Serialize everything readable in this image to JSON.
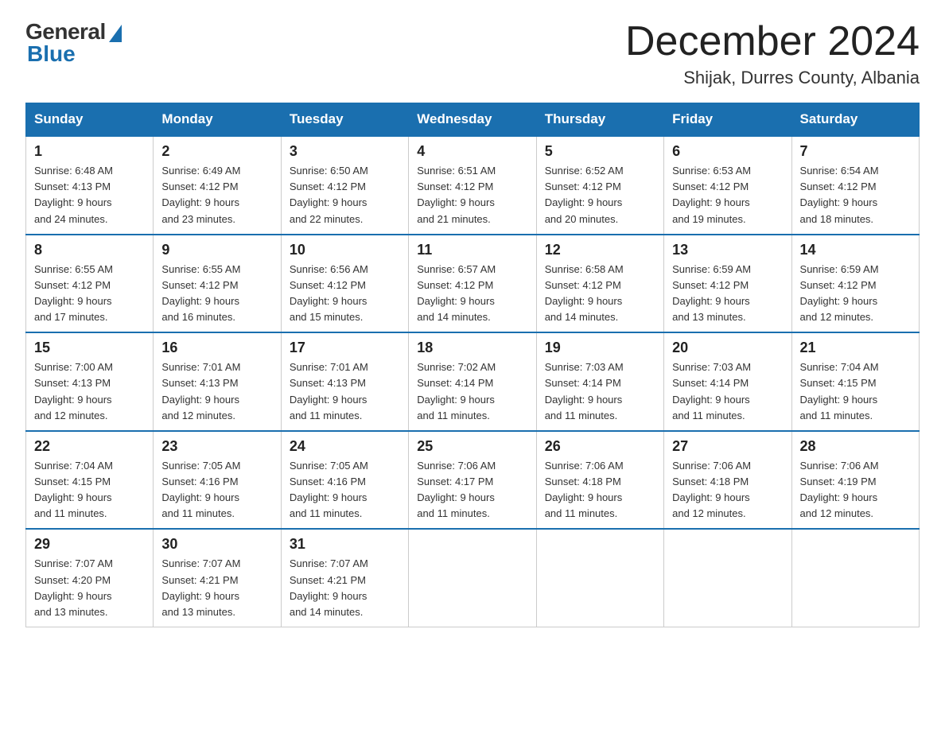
{
  "header": {
    "logo_general": "General",
    "logo_blue": "Blue",
    "month_title": "December 2024",
    "location": "Shijak, Durres County, Albania"
  },
  "days_of_week": [
    "Sunday",
    "Monday",
    "Tuesday",
    "Wednesday",
    "Thursday",
    "Friday",
    "Saturday"
  ],
  "weeks": [
    [
      {
        "day": "1",
        "sunrise": "6:48 AM",
        "sunset": "4:13 PM",
        "daylight": "9 hours and 24 minutes."
      },
      {
        "day": "2",
        "sunrise": "6:49 AM",
        "sunset": "4:12 PM",
        "daylight": "9 hours and 23 minutes."
      },
      {
        "day": "3",
        "sunrise": "6:50 AM",
        "sunset": "4:12 PM",
        "daylight": "9 hours and 22 minutes."
      },
      {
        "day": "4",
        "sunrise": "6:51 AM",
        "sunset": "4:12 PM",
        "daylight": "9 hours and 21 minutes."
      },
      {
        "day": "5",
        "sunrise": "6:52 AM",
        "sunset": "4:12 PM",
        "daylight": "9 hours and 20 minutes."
      },
      {
        "day": "6",
        "sunrise": "6:53 AM",
        "sunset": "4:12 PM",
        "daylight": "9 hours and 19 minutes."
      },
      {
        "day": "7",
        "sunrise": "6:54 AM",
        "sunset": "4:12 PM",
        "daylight": "9 hours and 18 minutes."
      }
    ],
    [
      {
        "day": "8",
        "sunrise": "6:55 AM",
        "sunset": "4:12 PM",
        "daylight": "9 hours and 17 minutes."
      },
      {
        "day": "9",
        "sunrise": "6:55 AM",
        "sunset": "4:12 PM",
        "daylight": "9 hours and 16 minutes."
      },
      {
        "day": "10",
        "sunrise": "6:56 AM",
        "sunset": "4:12 PM",
        "daylight": "9 hours and 15 minutes."
      },
      {
        "day": "11",
        "sunrise": "6:57 AM",
        "sunset": "4:12 PM",
        "daylight": "9 hours and 14 minutes."
      },
      {
        "day": "12",
        "sunrise": "6:58 AM",
        "sunset": "4:12 PM",
        "daylight": "9 hours and 14 minutes."
      },
      {
        "day": "13",
        "sunrise": "6:59 AM",
        "sunset": "4:12 PM",
        "daylight": "9 hours and 13 minutes."
      },
      {
        "day": "14",
        "sunrise": "6:59 AM",
        "sunset": "4:12 PM",
        "daylight": "9 hours and 12 minutes."
      }
    ],
    [
      {
        "day": "15",
        "sunrise": "7:00 AM",
        "sunset": "4:13 PM",
        "daylight": "9 hours and 12 minutes."
      },
      {
        "day": "16",
        "sunrise": "7:01 AM",
        "sunset": "4:13 PM",
        "daylight": "9 hours and 12 minutes."
      },
      {
        "day": "17",
        "sunrise": "7:01 AM",
        "sunset": "4:13 PM",
        "daylight": "9 hours and 11 minutes."
      },
      {
        "day": "18",
        "sunrise": "7:02 AM",
        "sunset": "4:14 PM",
        "daylight": "9 hours and 11 minutes."
      },
      {
        "day": "19",
        "sunrise": "7:03 AM",
        "sunset": "4:14 PM",
        "daylight": "9 hours and 11 minutes."
      },
      {
        "day": "20",
        "sunrise": "7:03 AM",
        "sunset": "4:14 PM",
        "daylight": "9 hours and 11 minutes."
      },
      {
        "day": "21",
        "sunrise": "7:04 AM",
        "sunset": "4:15 PM",
        "daylight": "9 hours and 11 minutes."
      }
    ],
    [
      {
        "day": "22",
        "sunrise": "7:04 AM",
        "sunset": "4:15 PM",
        "daylight": "9 hours and 11 minutes."
      },
      {
        "day": "23",
        "sunrise": "7:05 AM",
        "sunset": "4:16 PM",
        "daylight": "9 hours and 11 minutes."
      },
      {
        "day": "24",
        "sunrise": "7:05 AM",
        "sunset": "4:16 PM",
        "daylight": "9 hours and 11 minutes."
      },
      {
        "day": "25",
        "sunrise": "7:06 AM",
        "sunset": "4:17 PM",
        "daylight": "9 hours and 11 minutes."
      },
      {
        "day": "26",
        "sunrise": "7:06 AM",
        "sunset": "4:18 PM",
        "daylight": "9 hours and 11 minutes."
      },
      {
        "day": "27",
        "sunrise": "7:06 AM",
        "sunset": "4:18 PM",
        "daylight": "9 hours and 12 minutes."
      },
      {
        "day": "28",
        "sunrise": "7:06 AM",
        "sunset": "4:19 PM",
        "daylight": "9 hours and 12 minutes."
      }
    ],
    [
      {
        "day": "29",
        "sunrise": "7:07 AM",
        "sunset": "4:20 PM",
        "daylight": "9 hours and 13 minutes."
      },
      {
        "day": "30",
        "sunrise": "7:07 AM",
        "sunset": "4:21 PM",
        "daylight": "9 hours and 13 minutes."
      },
      {
        "day": "31",
        "sunrise": "7:07 AM",
        "sunset": "4:21 PM",
        "daylight": "9 hours and 14 minutes."
      },
      null,
      null,
      null,
      null
    ]
  ],
  "labels": {
    "sunrise": "Sunrise:",
    "sunset": "Sunset:",
    "daylight": "Daylight:"
  }
}
